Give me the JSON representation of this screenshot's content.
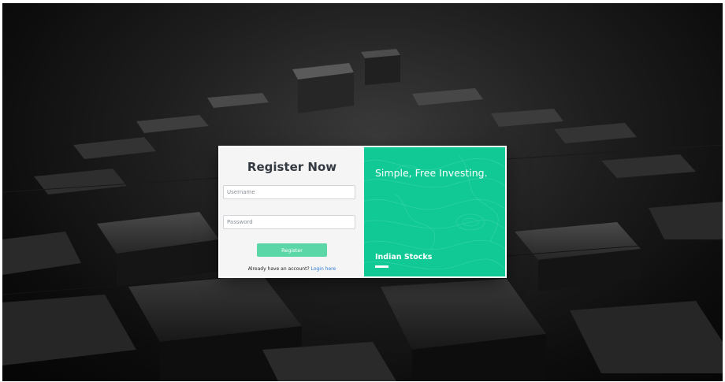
{
  "register_form": {
    "title": "Register Now",
    "username": {
      "placeholder": "Username",
      "value": ""
    },
    "password": {
      "placeholder": "Password",
      "value": ""
    },
    "register_label": "Register",
    "login_prompt": "Already have an account?",
    "login_link": "Login here"
  },
  "promo": {
    "headline": "Simple, Free Investing.",
    "label": "Indian Stocks",
    "color": "#10c995"
  },
  "theme": {
    "register_button_color": "#5bd6a6",
    "link_color": "#2b7bd8"
  }
}
